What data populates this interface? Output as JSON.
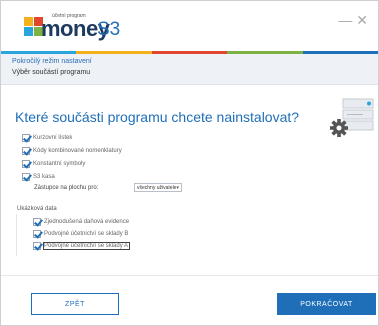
{
  "app": {
    "logo_word": "money",
    "logo_product": "S3",
    "logo_small_text": "účetní program",
    "close_glyph": "— ✕",
    "brand_colors": [
      "#2aa5dc",
      "#f3b11c",
      "#e2462f",
      "#7cb342",
      "#1f6fb8"
    ]
  },
  "breadcrumb": {
    "mode": "Pokročilý režim nastavení",
    "step": "Výběr součástí programu"
  },
  "main": {
    "title": "Které součásti programu chcete nainstalovat?",
    "illustration_icon": "server-gear-icon",
    "components": [
      {
        "label": "Kurzovní lístek",
        "checked": true
      },
      {
        "label": "Kódy kombinované nomenklatury",
        "checked": true
      },
      {
        "label": "Konstantní symboly",
        "checked": true
      },
      {
        "label": "S3 kasa",
        "checked": true
      }
    ],
    "assign_label": "Zástupce na plochu pro:",
    "assign_select_value": "všechny uživatele",
    "sample_data_label": "Ukázková data",
    "sample_data": [
      {
        "label": "Zjednodušená daňová evidence",
        "checked": true
      },
      {
        "label": "Podvojné účetnictví se sklady B",
        "checked": true
      },
      {
        "label": "Podvojné účetnictví se sklady A",
        "checked": true
      }
    ]
  },
  "footer": {
    "back_label": "ZPĚT",
    "next_label": "POKRAČOVAT"
  }
}
